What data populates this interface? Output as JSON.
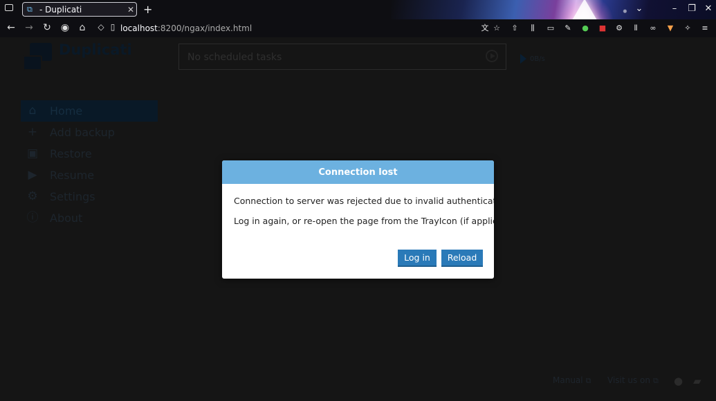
{
  "browser": {
    "tab_title": "- Duplicati",
    "tab_close": "✕",
    "new_tab": "+",
    "url_host": "localhost",
    "url_rest": ":8200/ngax/index.html",
    "window_controls": [
      "⌄",
      "–",
      "❐",
      "✕"
    ]
  },
  "app": {
    "logo_text": "Duplicati",
    "schedule_text": "No scheduled tasks",
    "speed_text": "0B/s",
    "menu": [
      {
        "label": "Home",
        "icon": "home-icon"
      },
      {
        "label": "Add backup",
        "icon": "plus-icon"
      },
      {
        "label": "Restore",
        "icon": "restore-icon"
      },
      {
        "label": "Resume",
        "icon": "play-icon"
      },
      {
        "label": "Settings",
        "icon": "gear-icon"
      },
      {
        "label": "About",
        "icon": "info-icon"
      }
    ],
    "footer": {
      "manual": "Manual",
      "visit": "Visit us on"
    }
  },
  "dialog": {
    "title": "Connection lost",
    "message1": "Connection to server was rejected due to invalid authentication.",
    "message2": "Log in again, or re-open the page from the TrayIcon (if applicable)",
    "login_label": "Log in",
    "reload_label": "Reload"
  },
  "colors": {
    "dialog_header": "#6cb1e0",
    "button": "#2a7ab8",
    "page_bg": "#1c1c1c"
  }
}
